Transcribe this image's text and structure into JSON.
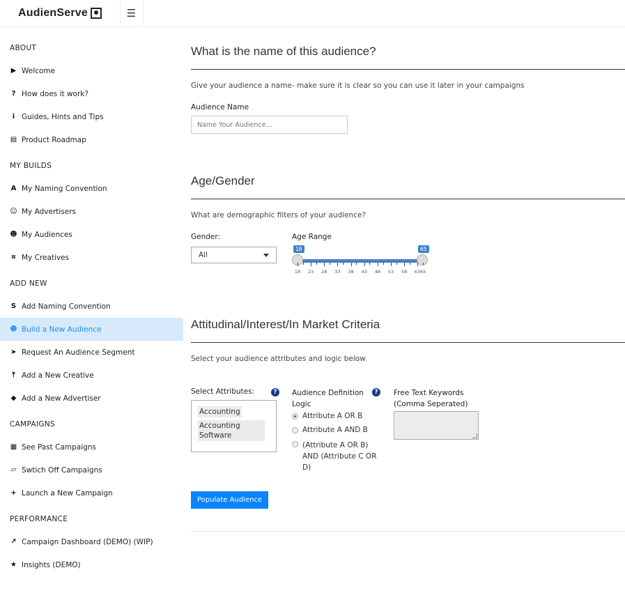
{
  "app": {
    "brand": "AudienServe"
  },
  "sidebar": {
    "sections": [
      {
        "title": "ABOUT",
        "items": [
          {
            "label": "Welcome",
            "icon": "play-icon"
          },
          {
            "label": "How does it work?",
            "icon": "question-icon"
          },
          {
            "label": "Guides, Hints and Tips",
            "icon": "info-icon"
          },
          {
            "label": "Product Roadmap",
            "icon": "map-icon"
          }
        ]
      },
      {
        "title": "MY BUILDS",
        "items": [
          {
            "label": "My Naming Convention",
            "icon": "font-icon"
          },
          {
            "label": "My Advertisers",
            "icon": "user-check-icon"
          },
          {
            "label": "My Audiences",
            "icon": "user-icon"
          },
          {
            "label": "My Creatives",
            "icon": "crop-icon"
          }
        ]
      },
      {
        "title": "ADD NEW",
        "items": [
          {
            "label": "Add Naming Convention",
            "icon": "strikethrough-icon"
          },
          {
            "label": "Build a New Audience",
            "icon": "user-plus-icon",
            "active": true
          },
          {
            "label": "Request An Audience Segment",
            "icon": "paper-plane-icon"
          },
          {
            "label": "Add a New Creative",
            "icon": "upload-icon"
          },
          {
            "label": "Add a New Advertiser",
            "icon": "tag-icon"
          }
        ]
      },
      {
        "title": "CAMPAIGNS",
        "items": [
          {
            "label": "See Past Campaigns",
            "icon": "calendar-icon"
          },
          {
            "label": "Swtich Off Campaigns",
            "icon": "eraser-icon"
          },
          {
            "label": "Launch a New Campaign",
            "icon": "plus-icon"
          }
        ]
      },
      {
        "title": "PERFORMANCE",
        "items": [
          {
            "label": "Campaign Dashboard (DEMO) (WIP)",
            "icon": "chart-line-icon"
          },
          {
            "label": "Insights (DEMO)",
            "icon": "star-icon"
          }
        ]
      }
    ],
    "active_color": "#1f8ef1",
    "active_bg": "#d6eafc"
  },
  "name_section": {
    "heading": "What is the name of this audience?",
    "description": "Give your audience a name- make sure it is clear so you can use it later in your campaigns",
    "field_label": "Audience Name",
    "placeholder": "Name Your Audience..."
  },
  "age_gender": {
    "heading": "Age/Gender",
    "description": "What are demographic filters of your audience?",
    "gender_label": "Gender:",
    "gender_value": "All",
    "age_label": "Age Range",
    "age_min": 18,
    "age_max": 65,
    "min_badge": "18",
    "max_badge": "65",
    "tick_labels": [
      "18",
      "23",
      "28",
      "33",
      "38",
      "43",
      "48",
      "53",
      "58",
      "6365"
    ]
  },
  "criteria": {
    "heading": "Attitudinal/Interest/In Market Criteria",
    "description": "Select your audience attributes and logic below",
    "attributes_label": "Select Attributes:",
    "attributes": [
      "Accounting",
      "Accounting Software"
    ],
    "logic_label": "Audience Definition Logic",
    "logic_options": [
      {
        "label": "Attribute A OR B",
        "checked": true
      },
      {
        "label": "Attribute A AND B",
        "checked": false
      },
      {
        "label": "(Attribute A OR B) AND (Attribute C OR D)",
        "checked": false
      }
    ],
    "keywords_label": "Free Text Keywords (Comma Seperated)",
    "button": "Populate Audience"
  },
  "colors": {
    "primary_button": "#0a84ff",
    "slider": "#3f83c6",
    "help_icon": "#1a3a8a"
  }
}
